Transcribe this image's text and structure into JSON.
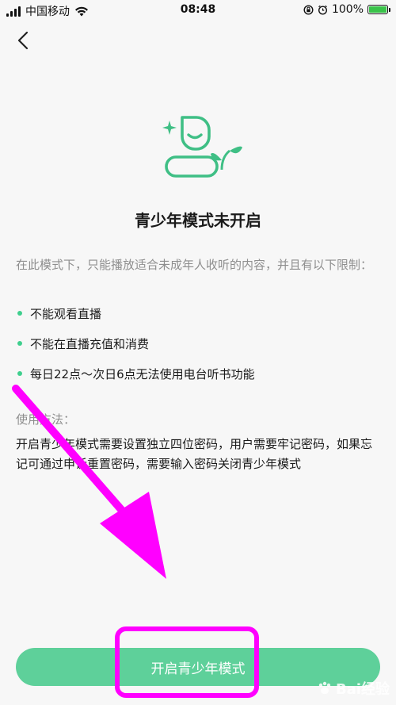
{
  "status_bar": {
    "carrier": "中国移动",
    "time": "08:48",
    "battery": "100%"
  },
  "icons": {
    "back": "back-arrow-icon",
    "illustration": "teen-mode-plant-icon"
  },
  "page": {
    "title": "青少年模式未开启",
    "intro": "在此模式下，只能播放适合未成年人收听的内容，并且有以下限制：",
    "restrictions": [
      "不能观看直播",
      "不能在直播充值和消费",
      "每日22点～次日6点无法使用电台听书功能"
    ],
    "usage_heading": "使用方法：",
    "usage_text": "开启青少年模式需要设置独立四位密码，用户需要牢记密码，如果忘记可通过申诉重置密码，需要输入密码关闭青少年模式"
  },
  "actions": {
    "enable_label": "开启青少年模式"
  },
  "watermark": {
    "text": "Bai经验"
  },
  "colors": {
    "accent": "#5ed09a",
    "bullet": "#3fcf8e",
    "annotation": "#ff00ff",
    "background": "#f7f7f7"
  }
}
